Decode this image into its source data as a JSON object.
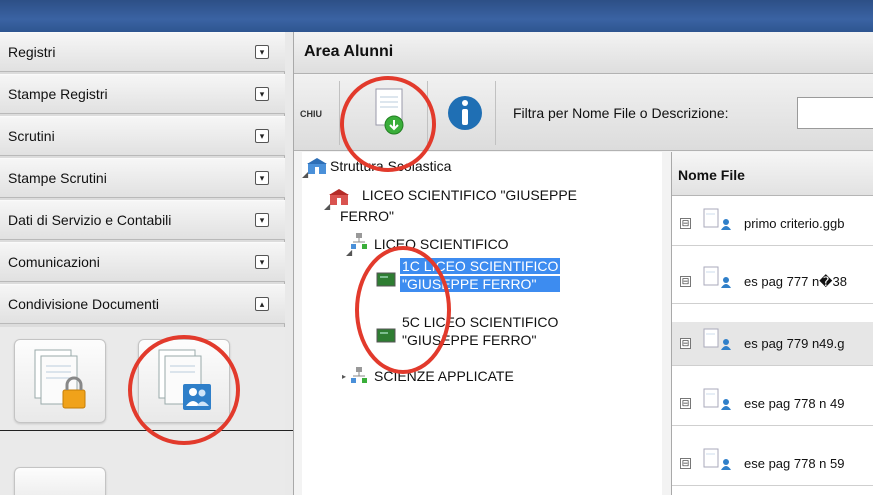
{
  "sidebar": {
    "items": [
      {
        "label": "Registri",
        "toggle": "▾"
      },
      {
        "label": "Stampe Registri",
        "toggle": "▾"
      },
      {
        "label": "Scrutini",
        "toggle": "▾"
      },
      {
        "label": "Stampe Scrutini",
        "toggle": "▾"
      },
      {
        "label": "Dati di Servizio e Contabili",
        "toggle": "▾"
      },
      {
        "label": "Comunicazioni",
        "toggle": "▾"
      },
      {
        "label": "Condivisione Documenti",
        "toggle": "▴"
      }
    ]
  },
  "main": {
    "title": "Area Alunni",
    "toolbar": {
      "close_label": "CHIU",
      "filter_label": "Filtra per Nome File o Descrizione:",
      "filter_value": ""
    },
    "tree": {
      "root": "Struttura Scolastica",
      "school": "LICEO SCIENTIFICO \"GIUSEPPE",
      "school_2": "FERRO\"",
      "branch": "LICEO SCIENTIFICO",
      "class_1a": "1C LICEO SCIENTIFICO",
      "class_1b": "\"GIUSEPPE FERRO\"",
      "class_2a": "5C LICEO SCIENTIFICO",
      "class_2b": "\"GIUSEPPE FERRO\"",
      "branch_2": "SCIENZE APPLICATE"
    },
    "files": {
      "header": "Nome File",
      "rows": [
        {
          "name": "primo criterio.ggb",
          "toggle": "⊟"
        },
        {
          "name": "es pag 777 n�38",
          "toggle": "⊟"
        },
        {
          "name": "es pag 779 n49.g",
          "toggle": "⊟"
        },
        {
          "name": "ese pag 778 n 49",
          "toggle": "⊟"
        },
        {
          "name": "ese pag 778 n 59",
          "toggle": "⊟"
        }
      ]
    }
  },
  "colors": {
    "accent": "#e23a2c",
    "selection": "#3d8cf0",
    "topbar": "#3a63a3"
  }
}
